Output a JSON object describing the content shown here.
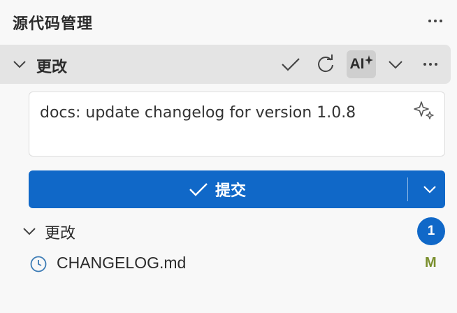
{
  "panel": {
    "title": "源代码管理",
    "more_icon": "ellipsis-icon"
  },
  "changes_section": {
    "label": "更改",
    "actions": [
      {
        "name": "commit-check",
        "icon": "check-icon"
      },
      {
        "name": "refresh",
        "icon": "refresh-icon"
      },
      {
        "name": "ai-generate",
        "icon": "ai-sparkle-icon",
        "label": "AI"
      },
      {
        "name": "expand",
        "icon": "chevron-down-icon"
      },
      {
        "name": "more",
        "icon": "ellipsis-icon"
      }
    ]
  },
  "commit_message": {
    "value": "docs: update changelog for version 1.0.8",
    "sparkle_icon": "sparkle-icon"
  },
  "commit_button": {
    "label": "提交",
    "icon": "check-icon",
    "dropdown_icon": "chevron-down-icon"
  },
  "changes_group": {
    "label": "更改",
    "count": "1",
    "files": [
      {
        "name": "CHANGELOG.md",
        "status": "M",
        "icon": "clock-icon"
      }
    ]
  },
  "colors": {
    "accent": "#1068c8",
    "header_bg": "#e4e4e4",
    "background": "#f8f8f8",
    "modified": "#7a8f2e"
  }
}
